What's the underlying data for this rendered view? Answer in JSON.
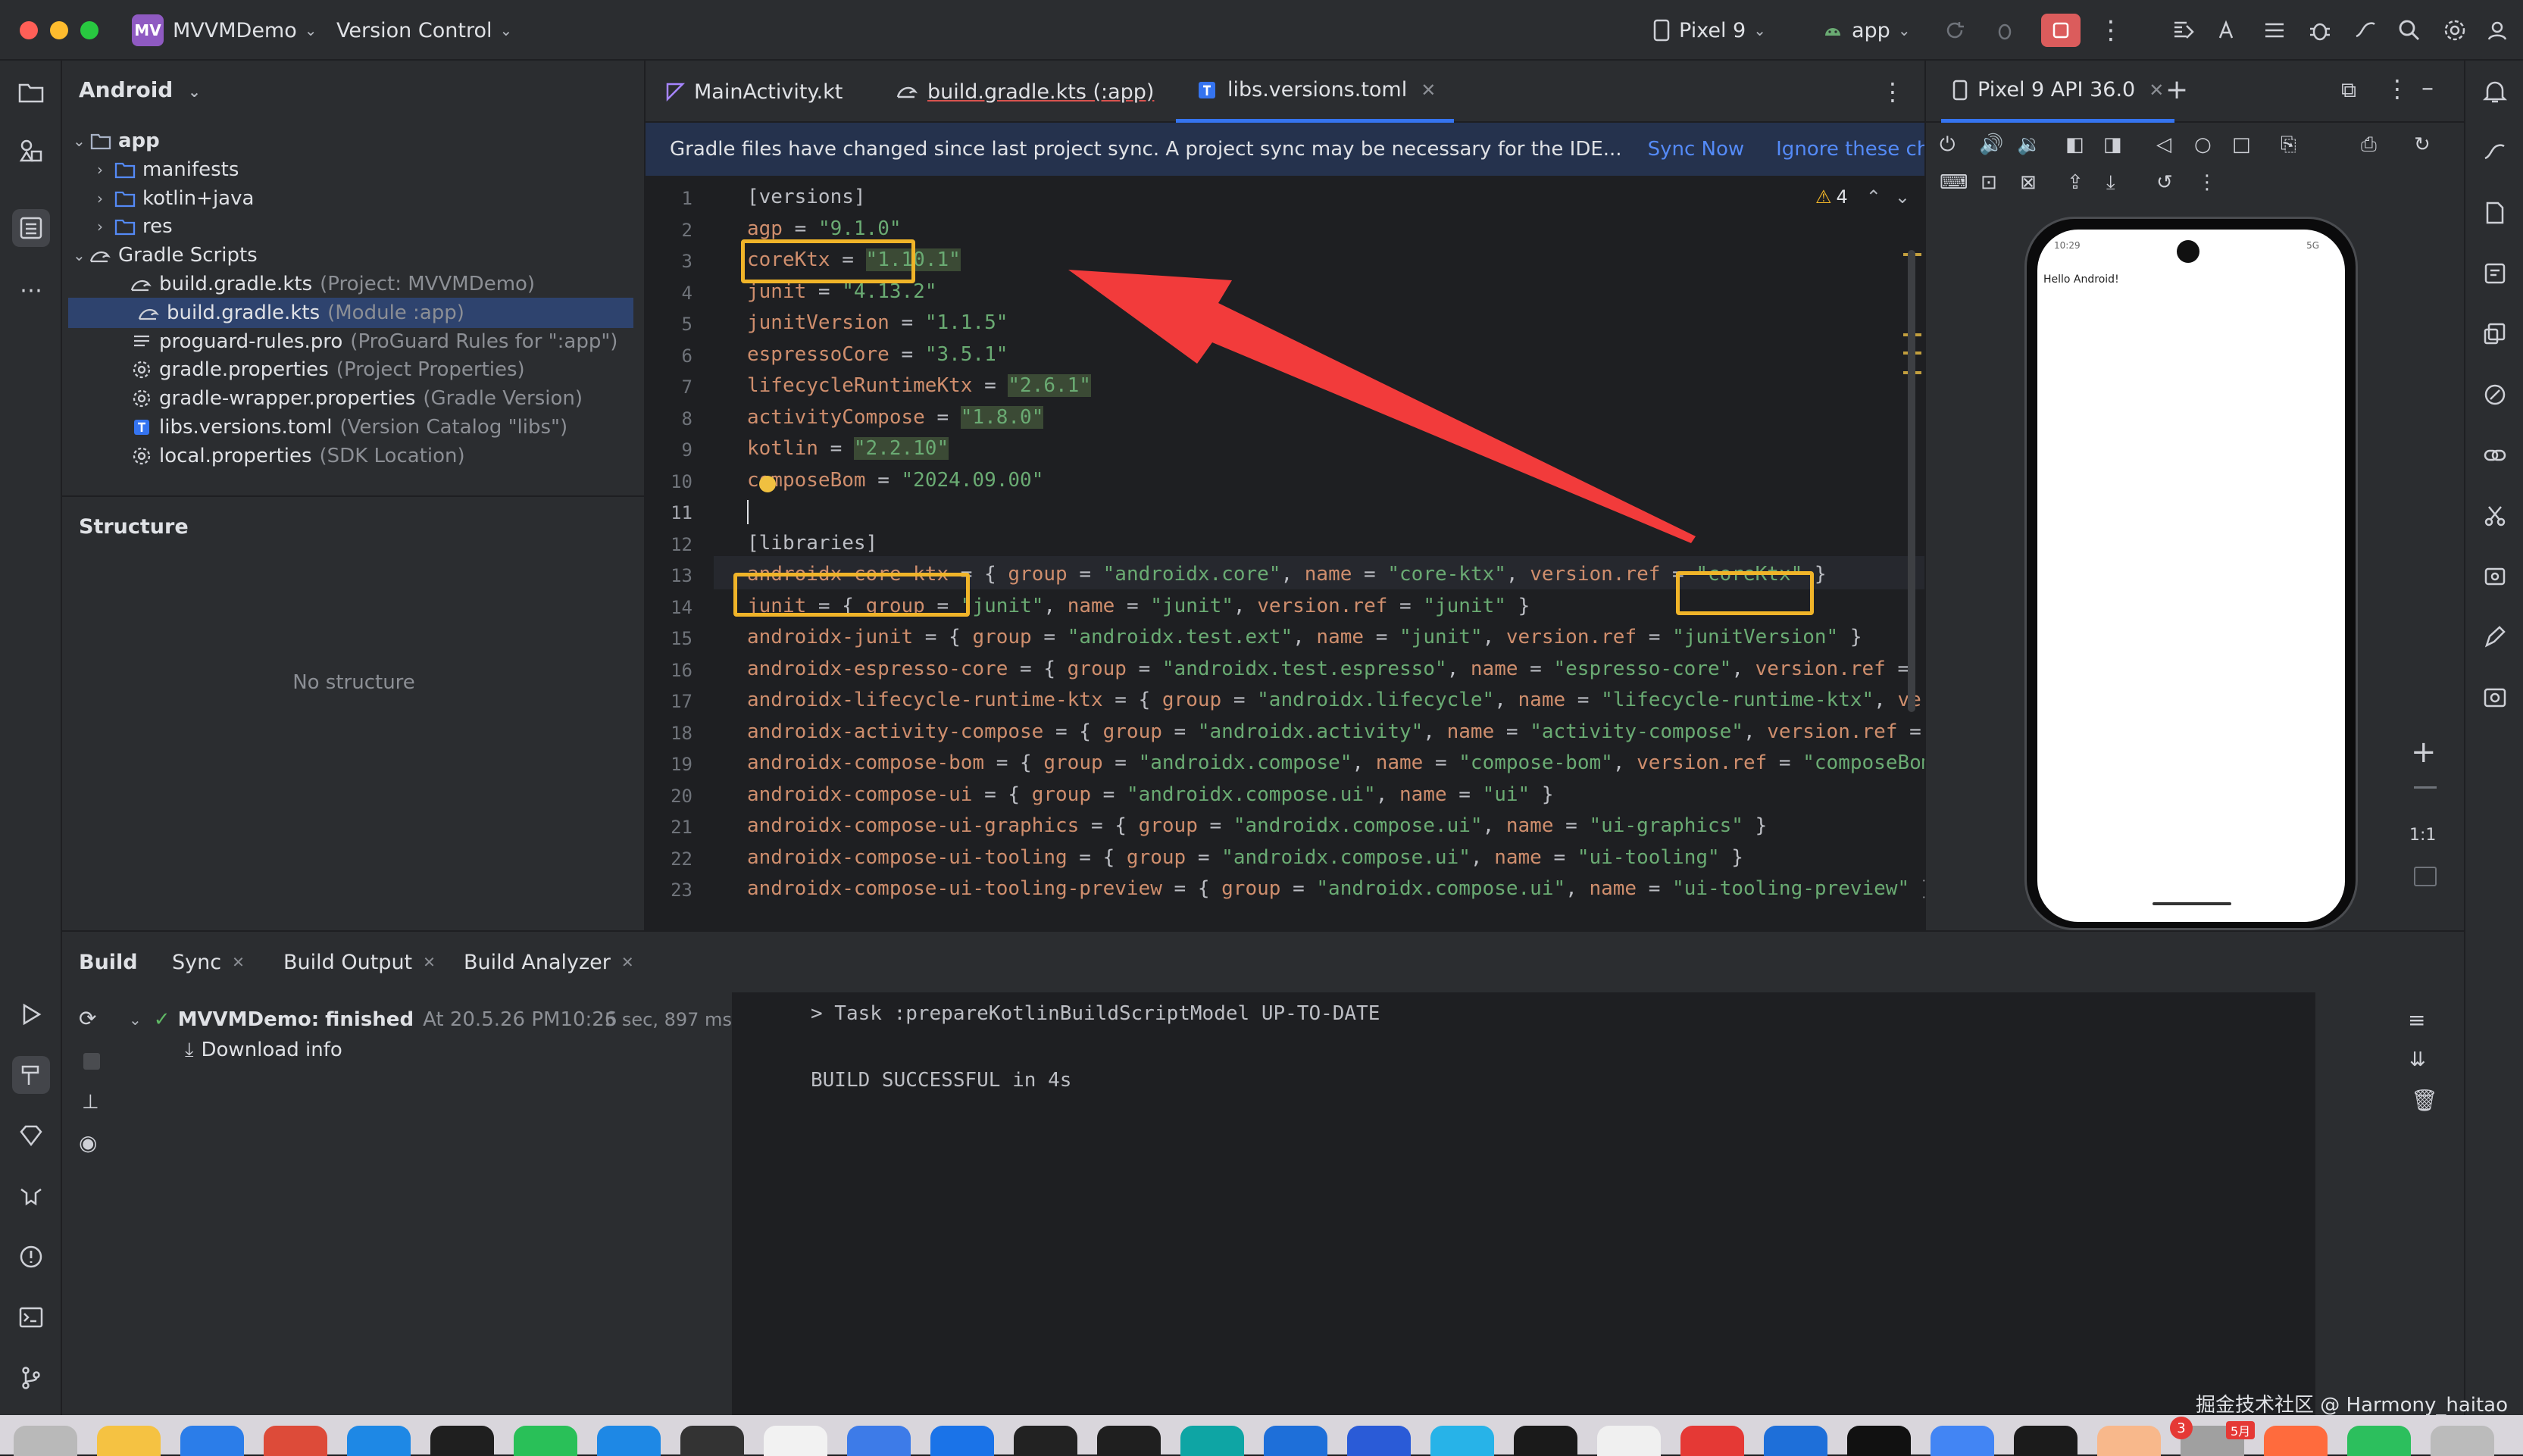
{
  "titlebar": {
    "project_badge": "MV",
    "project_name": "MVVMDemo",
    "vcs": "Version Control",
    "device": "Pixel 9",
    "run_config": "app"
  },
  "project_panel": {
    "view": "Android",
    "tree": [
      {
        "label": "app",
        "muted": "",
        "level": 0,
        "expanded": true,
        "icon": "module-folder-icon"
      },
      {
        "label": "manifests",
        "muted": "",
        "level": 1,
        "expanded": false,
        "icon": "folder-icon"
      },
      {
        "label": "kotlin+java",
        "muted": "",
        "level": 1,
        "expanded": false,
        "icon": "folder-icon"
      },
      {
        "label": "res",
        "muted": "",
        "level": 1,
        "expanded": false,
        "icon": "folder-icon"
      },
      {
        "label": "Gradle Scripts",
        "muted": "",
        "level": 0,
        "expanded": true,
        "icon": "gradle-icon"
      },
      {
        "label": "build.gradle.kts",
        "muted": "(Project: MVVMDemo)",
        "level": 2,
        "icon": "gradle-file-icon"
      },
      {
        "label": "build.gradle.kts",
        "muted": "(Module :app)",
        "level": 2,
        "icon": "gradle-file-icon",
        "selected": true
      },
      {
        "label": "proguard-rules.pro",
        "muted": "(ProGuard Rules for \":app\")",
        "level": 2,
        "icon": "text-file-icon"
      },
      {
        "label": "gradle.properties",
        "muted": "(Project Properties)",
        "level": 2,
        "icon": "settings-file-icon"
      },
      {
        "label": "gradle-wrapper.properties",
        "muted": "(Gradle Version)",
        "level": 2,
        "icon": "settings-file-icon"
      },
      {
        "label": "libs.versions.toml",
        "muted": "(Version Catalog \"libs\")",
        "level": 2,
        "icon": "toml-file-icon"
      },
      {
        "label": "local.properties",
        "muted": "(SDK Location)",
        "level": 2,
        "icon": "settings-file-icon"
      }
    ],
    "structure_title": "Structure",
    "structure_empty": "No structure"
  },
  "editor": {
    "tabs": [
      {
        "label": "MainActivity.kt",
        "icon": "kotlin-file-icon",
        "active": false
      },
      {
        "label": "build.gradle.kts (:app)",
        "icon": "gradle-file-icon",
        "active": false
      },
      {
        "label": "libs.versions.toml",
        "icon": "toml-file-icon",
        "active": true
      }
    ],
    "banner_message": "Gradle files have changed since last project sync. A project sync may be necessary for the IDE...",
    "sync_now": "Sync Now",
    "ignore": "Ignore these changes",
    "warnings_count": "4",
    "current_line": 11,
    "lines": [
      [
        {
          "t": "[versions]",
          "c": "t"
        }
      ],
      [
        {
          "t": "agp",
          "c": "k"
        },
        {
          "t": " = ",
          "c": "t"
        },
        {
          "t": "\"9.1.0\"",
          "c": "s"
        }
      ],
      [
        {
          "t": "coreKtx",
          "c": "k"
        },
        {
          "t": " = ",
          "c": "t"
        },
        {
          "t": "\"1.10.1\"",
          "c": "hl"
        }
      ],
      [
        {
          "t": "junit",
          "c": "k"
        },
        {
          "t": " = ",
          "c": "t"
        },
        {
          "t": "\"4.13.2\"",
          "c": "s"
        }
      ],
      [
        {
          "t": "junitVersion",
          "c": "k"
        },
        {
          "t": " = ",
          "c": "t"
        },
        {
          "t": "\"1.1.5\"",
          "c": "s"
        }
      ],
      [
        {
          "t": "espressoCore",
          "c": "k"
        },
        {
          "t": " = ",
          "c": "t"
        },
        {
          "t": "\"3.5.1\"",
          "c": "s"
        }
      ],
      [
        {
          "t": "lifecycleRuntimeKtx",
          "c": "k"
        },
        {
          "t": " = ",
          "c": "t"
        },
        {
          "t": "\"2.6.1\"",
          "c": "hl"
        }
      ],
      [
        {
          "t": "activityCompose",
          "c": "k"
        },
        {
          "t": " = ",
          "c": "t"
        },
        {
          "t": "\"1.8.0\"",
          "c": "hl"
        }
      ],
      [
        {
          "t": "kotlin",
          "c": "k"
        },
        {
          "t": " = ",
          "c": "t"
        },
        {
          "t": "\"2.2.10\"",
          "c": "hl"
        }
      ],
      [
        {
          "t": "composeBom",
          "c": "k"
        },
        {
          "t": " = ",
          "c": "t"
        },
        {
          "t": "\"2024.09.00\"",
          "c": "s"
        }
      ],
      [
        {
          "t": "",
          "c": "t"
        }
      ],
      [
        {
          "t": "[libraries]",
          "c": "t"
        }
      ],
      [
        {
          "t": "androidx-core-ktx",
          "c": "k"
        },
        {
          "t": " = { ",
          "c": "t"
        },
        {
          "t": "group",
          "c": "k"
        },
        {
          "t": " = ",
          "c": "t"
        },
        {
          "t": "\"androidx.core\"",
          "c": "s"
        },
        {
          "t": ", ",
          "c": "t"
        },
        {
          "t": "name",
          "c": "k"
        },
        {
          "t": " = ",
          "c": "t"
        },
        {
          "t": "\"core-ktx\"",
          "c": "s"
        },
        {
          "t": ", ",
          "c": "t"
        },
        {
          "t": "version.ref",
          "c": "k"
        },
        {
          "t": " = ",
          "c": "t"
        },
        {
          "t": "\"coreKtx\"",
          "c": "s"
        },
        {
          "t": " }",
          "c": "t"
        }
      ],
      [
        {
          "t": "junit",
          "c": "k"
        },
        {
          "t": " = { ",
          "c": "t"
        },
        {
          "t": "group",
          "c": "k"
        },
        {
          "t": " = ",
          "c": "t"
        },
        {
          "t": "\"junit\"",
          "c": "s"
        },
        {
          "t": ", ",
          "c": "t"
        },
        {
          "t": "name",
          "c": "k"
        },
        {
          "t": " = ",
          "c": "t"
        },
        {
          "t": "\"junit\"",
          "c": "s"
        },
        {
          "t": ", ",
          "c": "t"
        },
        {
          "t": "version.ref",
          "c": "k"
        },
        {
          "t": " = ",
          "c": "t"
        },
        {
          "t": "\"junit\"",
          "c": "s"
        },
        {
          "t": " }",
          "c": "t"
        }
      ],
      [
        {
          "t": "androidx-junit",
          "c": "k"
        },
        {
          "t": " = { ",
          "c": "t"
        },
        {
          "t": "group",
          "c": "k"
        },
        {
          "t": " = ",
          "c": "t"
        },
        {
          "t": "\"androidx.test.ext\"",
          "c": "s"
        },
        {
          "t": ", ",
          "c": "t"
        },
        {
          "t": "name",
          "c": "k"
        },
        {
          "t": " = ",
          "c": "t"
        },
        {
          "t": "\"junit\"",
          "c": "s"
        },
        {
          "t": ", ",
          "c": "t"
        },
        {
          "t": "version.ref",
          "c": "k"
        },
        {
          "t": " = ",
          "c": "t"
        },
        {
          "t": "\"junitVersion\"",
          "c": "s"
        },
        {
          "t": " }",
          "c": "t"
        }
      ],
      [
        {
          "t": "androidx-espresso-core",
          "c": "k"
        },
        {
          "t": " = { ",
          "c": "t"
        },
        {
          "t": "group",
          "c": "k"
        },
        {
          "t": " = ",
          "c": "t"
        },
        {
          "t": "\"androidx.test.espresso\"",
          "c": "s"
        },
        {
          "t": ", ",
          "c": "t"
        },
        {
          "t": "name",
          "c": "k"
        },
        {
          "t": " = ",
          "c": "t"
        },
        {
          "t": "\"espresso-core\"",
          "c": "s"
        },
        {
          "t": ", ",
          "c": "t"
        },
        {
          "t": "version.ref",
          "c": "k"
        },
        {
          "t": " = ",
          "c": "t"
        },
        {
          "t": "\"",
          "c": "s"
        }
      ],
      [
        {
          "t": "androidx-lifecycle-runtime-ktx",
          "c": "k"
        },
        {
          "t": " = { ",
          "c": "t"
        },
        {
          "t": "group",
          "c": "k"
        },
        {
          "t": " = ",
          "c": "t"
        },
        {
          "t": "\"androidx.lifecycle\"",
          "c": "s"
        },
        {
          "t": ", ",
          "c": "t"
        },
        {
          "t": "name",
          "c": "k"
        },
        {
          "t": " = ",
          "c": "t"
        },
        {
          "t": "\"lifecycle-runtime-ktx\"",
          "c": "s"
        },
        {
          "t": ", ",
          "c": "t"
        },
        {
          "t": "ver",
          "c": "k"
        }
      ],
      [
        {
          "t": "androidx-activity-compose",
          "c": "k"
        },
        {
          "t": " = { ",
          "c": "t"
        },
        {
          "t": "group",
          "c": "k"
        },
        {
          "t": " = ",
          "c": "t"
        },
        {
          "t": "\"androidx.activity\"",
          "c": "s"
        },
        {
          "t": ", ",
          "c": "t"
        },
        {
          "t": "name",
          "c": "k"
        },
        {
          "t": " = ",
          "c": "t"
        },
        {
          "t": "\"activity-compose\"",
          "c": "s"
        },
        {
          "t": ", ",
          "c": "t"
        },
        {
          "t": "version.ref",
          "c": "k"
        },
        {
          "t": " = ",
          "c": "t"
        }
      ],
      [
        {
          "t": "androidx-compose-bom",
          "c": "k"
        },
        {
          "t": " = { ",
          "c": "t"
        },
        {
          "t": "group",
          "c": "k"
        },
        {
          "t": " = ",
          "c": "t"
        },
        {
          "t": "\"androidx.compose\"",
          "c": "s"
        },
        {
          "t": ", ",
          "c": "t"
        },
        {
          "t": "name",
          "c": "k"
        },
        {
          "t": " = ",
          "c": "t"
        },
        {
          "t": "\"compose-bom\"",
          "c": "s"
        },
        {
          "t": ", ",
          "c": "t"
        },
        {
          "t": "version.ref",
          "c": "k"
        },
        {
          "t": " = ",
          "c": "t"
        },
        {
          "t": "\"composeBom",
          "c": "s"
        }
      ],
      [
        {
          "t": "androidx-compose-ui",
          "c": "k"
        },
        {
          "t": " = { ",
          "c": "t"
        },
        {
          "t": "group",
          "c": "k"
        },
        {
          "t": " = ",
          "c": "t"
        },
        {
          "t": "\"androidx.compose.ui\"",
          "c": "s"
        },
        {
          "t": ", ",
          "c": "t"
        },
        {
          "t": "name",
          "c": "k"
        },
        {
          "t": " = ",
          "c": "t"
        },
        {
          "t": "\"ui\"",
          "c": "s"
        },
        {
          "t": " }",
          "c": "t"
        }
      ],
      [
        {
          "t": "androidx-compose-ui-graphics",
          "c": "k"
        },
        {
          "t": " = { ",
          "c": "t"
        },
        {
          "t": "group",
          "c": "k"
        },
        {
          "t": " = ",
          "c": "t"
        },
        {
          "t": "\"androidx.compose.ui\"",
          "c": "s"
        },
        {
          "t": ", ",
          "c": "t"
        },
        {
          "t": "name",
          "c": "k"
        },
        {
          "t": " = ",
          "c": "t"
        },
        {
          "t": "\"ui-graphics\"",
          "c": "s"
        },
        {
          "t": " }",
          "c": "t"
        }
      ],
      [
        {
          "t": "androidx-compose-ui-tooling",
          "c": "k"
        },
        {
          "t": " = { ",
          "c": "t"
        },
        {
          "t": "group",
          "c": "k"
        },
        {
          "t": " = ",
          "c": "t"
        },
        {
          "t": "\"androidx.compose.ui\"",
          "c": "s"
        },
        {
          "t": ", ",
          "c": "t"
        },
        {
          "t": "name",
          "c": "k"
        },
        {
          "t": " = ",
          "c": "t"
        },
        {
          "t": "\"ui-tooling\"",
          "c": "s"
        },
        {
          "t": " }",
          "c": "t"
        }
      ],
      [
        {
          "t": "androidx-compose-ui-tooling-preview",
          "c": "k"
        },
        {
          "t": " = { ",
          "c": "t"
        },
        {
          "t": "group",
          "c": "k"
        },
        {
          "t": " = ",
          "c": "t"
        },
        {
          "t": "\"androidx.compose.ui\"",
          "c": "s"
        },
        {
          "t": ", ",
          "c": "t"
        },
        {
          "t": "name",
          "c": "k"
        },
        {
          "t": " = ",
          "c": "t"
        },
        {
          "t": "\"ui-tooling-preview\"",
          "c": "s"
        },
        {
          "t": " }",
          "c": "t"
        }
      ]
    ]
  },
  "device_panel": {
    "tab_label": "Pixel 9 API 36.0",
    "status_time": "10:29",
    "status_right": "5G",
    "screen_text": "Hello Android!",
    "zoom_label": "1:1"
  },
  "build_panel": {
    "tabs": [
      {
        "label": "Build",
        "closable": false
      },
      {
        "label": "Sync",
        "closable": true
      },
      {
        "label": "Build Output",
        "closable": true
      },
      {
        "label": "Build Analyzer",
        "closable": true
      }
    ],
    "result_title": "MVVMDemo:",
    "result_status": "finished",
    "result_time": "At 20.5.26 PM10:26",
    "result_duration": "5 sec, 897 ms",
    "download_info": "Download info",
    "console_lines": [
      "> Task :prepareKotlinBuildScriptModel UP-TO-DATE",
      "",
      "BUILD SUCCESSFUL in 4s"
    ]
  },
  "watermark": "掘金技术社区 @ Harmony_haitao",
  "dock": {
    "badges": [
      "3",
      "5月"
    ]
  },
  "colors": {
    "accent": "#3574f0",
    "annotation_box": "#f0b429",
    "annotation_arrow": "#f23b3b",
    "string": "#6aab73",
    "keyword": "#cf8e6d"
  }
}
